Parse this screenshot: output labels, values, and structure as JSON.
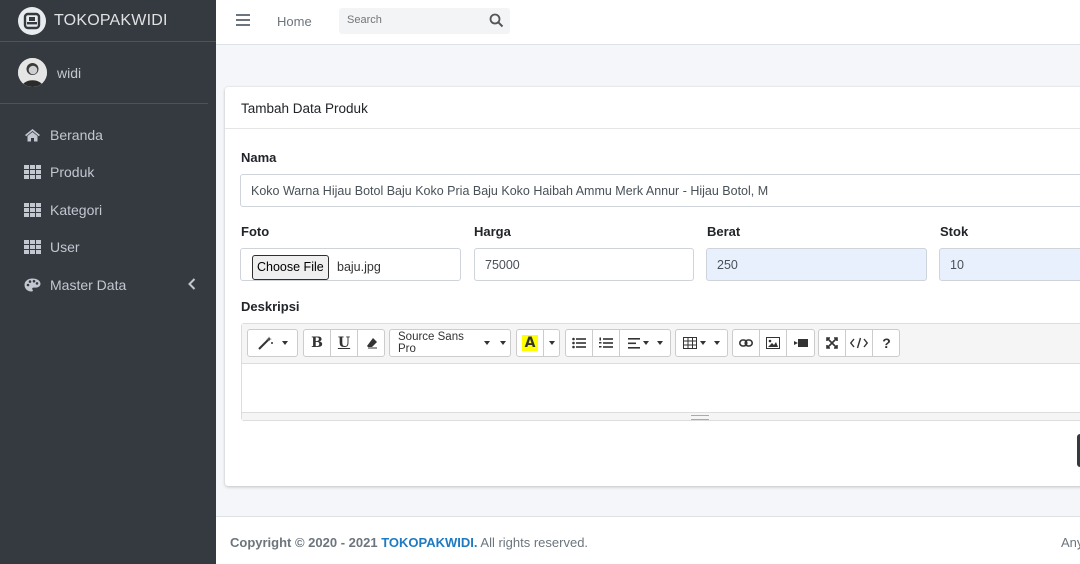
{
  "brand": {
    "name": "TOKOPAKWIDI",
    "logo_icon": "shield-logo-icon"
  },
  "user": {
    "name": "widi",
    "avatar_icon": "user-avatar"
  },
  "sidebar": {
    "items": [
      {
        "label": "Beranda",
        "icon": "home-icon"
      },
      {
        "label": "Produk",
        "icon": "grid-icon"
      },
      {
        "label": "Kategori",
        "icon": "grid-icon"
      },
      {
        "label": "User",
        "icon": "grid-icon"
      },
      {
        "label": "Master Data",
        "icon": "palette-icon",
        "expandable": true
      }
    ]
  },
  "topbar": {
    "home_label": "Home",
    "search_placeholder": "Search"
  },
  "card": {
    "title": "Tambah Data Produk",
    "fields": {
      "nama": {
        "label": "Nama",
        "value": "Koko Warna Hijau Botol Baju Koko Pria Baju Koko Haibah Ammu Merk Annur - Hijau Botol, M"
      },
      "foto": {
        "label": "Foto",
        "button": "Choose File",
        "file": "baju.jpg"
      },
      "harga": {
        "label": "Harga",
        "value": "75000"
      },
      "berat": {
        "label": "Berat",
        "value": "250"
      },
      "stok": {
        "label": "Stok",
        "value": "10"
      },
      "deskripsi": {
        "label": "Deskripsi"
      }
    },
    "editor": {
      "font_name": "Source Sans Pro",
      "bold": "B",
      "underline": "U",
      "color_letter": "A",
      "help": "?",
      "highlight_color": "#ffff00"
    }
  },
  "footer": {
    "copyright": "Copyright © 2020 - 2021 ",
    "brand": "TOKOPAKWIDI.",
    "rights": " All rights reserved.",
    "right_text": "Any"
  },
  "colors": {
    "sidebar_bg": "#343a40",
    "accent": "#1f7bc1",
    "autofill_bg": "#e8f0fe"
  }
}
